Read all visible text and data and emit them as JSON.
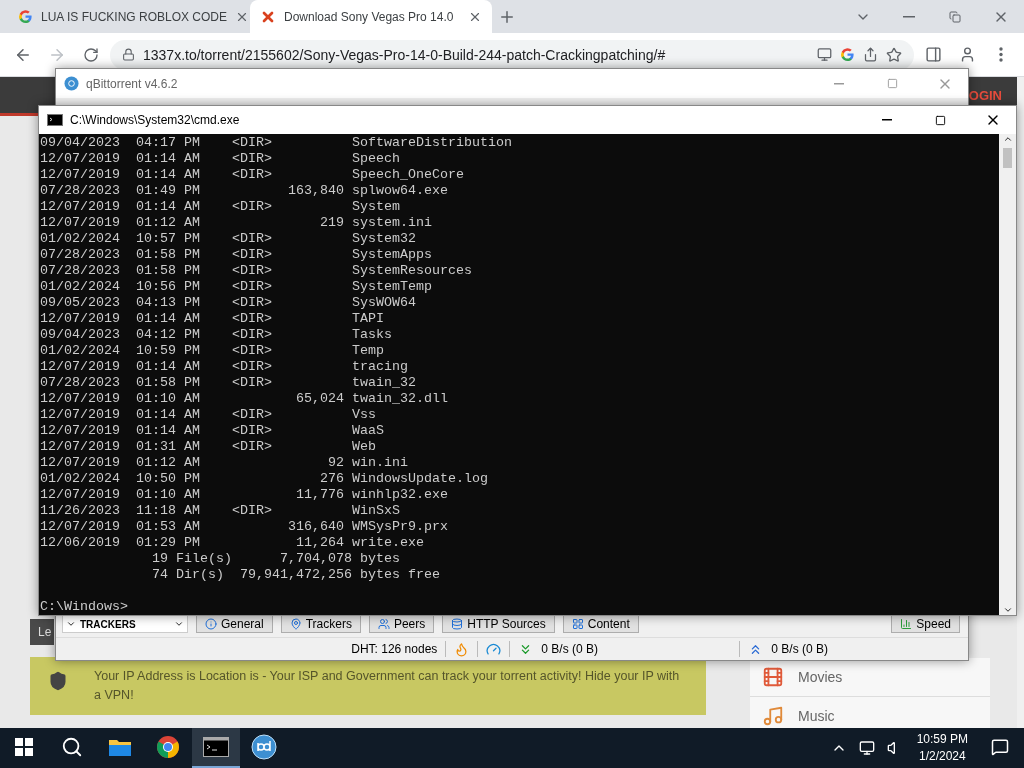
{
  "browser": {
    "tabs": [
      {
        "title": "LUA IS FUCKING ROBLOX CODE",
        "selected": false,
        "kind": "google"
      },
      {
        "title": "Download Sony Vegas Pro 14.0",
        "selected": true,
        "kind": "x"
      }
    ],
    "nav": {
      "back_disabled": false,
      "forward_disabled": true
    },
    "url": "1337x.to/torrent/2155602/Sony-Vegas-Pro-14-0-Build-244-patch-Crackingpatching/#",
    "page": {
      "login": "OGIN",
      "cut_label": "Le",
      "notice": "Your IP Address is Location is - Your ISP and Government can track your torrent activity! Hide your IP with a VPN!",
      "sidebar": [
        {
          "label": "Movies",
          "kind": "film"
        },
        {
          "label": "Music",
          "kind": "music"
        }
      ]
    }
  },
  "qbittorrent": {
    "title": "qBittorrent v4.6.2",
    "panel_header": "TRACKERS",
    "tabs": [
      {
        "label": "General",
        "kind": "info"
      },
      {
        "label": "Trackers",
        "kind": "tracker"
      },
      {
        "label": "Peers",
        "kind": "peers"
      },
      {
        "label": "HTTP Sources",
        "kind": "sources"
      },
      {
        "label": "Content",
        "kind": "content"
      }
    ],
    "speed_button": "Speed",
    "status": {
      "dht": "DHT: 126 nodes",
      "download": "0 B/s (0 B)",
      "upload": "0 B/s (0 B)"
    }
  },
  "cmd": {
    "title": "C:\\Windows\\System32\\cmd.exe",
    "lines": [
      "09/04/2023  04:17 PM    <DIR>          SoftwareDistribution",
      "12/07/2019  01:14 AM    <DIR>          Speech",
      "12/07/2019  01:14 AM    <DIR>          Speech_OneCore",
      "07/28/2023  01:49 PM           163,840 splwow64.exe",
      "12/07/2019  01:14 AM    <DIR>          System",
      "12/07/2019  01:12 AM               219 system.ini",
      "01/02/2024  10:57 PM    <DIR>          System32",
      "07/28/2023  01:58 PM    <DIR>          SystemApps",
      "07/28/2023  01:58 PM    <DIR>          SystemResources",
      "01/02/2024  10:56 PM    <DIR>          SystemTemp",
      "09/05/2023  04:13 PM    <DIR>          SysWOW64",
      "12/07/2019  01:14 AM    <DIR>          TAPI",
      "09/04/2023  04:12 PM    <DIR>          Tasks",
      "01/02/2024  10:59 PM    <DIR>          Temp",
      "12/07/2019  01:14 AM    <DIR>          tracing",
      "07/28/2023  01:58 PM    <DIR>          twain_32",
      "12/07/2019  01:10 AM            65,024 twain_32.dll",
      "12/07/2019  01:14 AM    <DIR>          Vss",
      "12/07/2019  01:14 AM    <DIR>          WaaS",
      "12/07/2019  01:31 AM    <DIR>          Web",
      "12/07/2019  01:12 AM                92 win.ini",
      "01/02/2024  10:50 PM               276 WindowsUpdate.log",
      "12/07/2019  01:10 AM            11,776 winhlp32.exe",
      "11/26/2023  11:18 AM    <DIR>          WinSxS",
      "12/07/2019  01:53 AM           316,640 WMSysPr9.prx",
      "12/06/2019  01:29 PM            11,264 write.exe",
      "              19 File(s)      7,704,078 bytes",
      "              74 Dir(s)  79,941,472,256 bytes free"
    ],
    "prompt": "C:\\Windows>"
  },
  "taskbar": {
    "apps": [
      {
        "kind": "explorer",
        "selected": false
      },
      {
        "kind": "chrome",
        "selected": false
      },
      {
        "kind": "cmd",
        "selected": true
      },
      {
        "kind": "qbittorrent",
        "selected": false
      }
    ],
    "time": "10:59 PM",
    "date": "1/2/2024"
  }
}
